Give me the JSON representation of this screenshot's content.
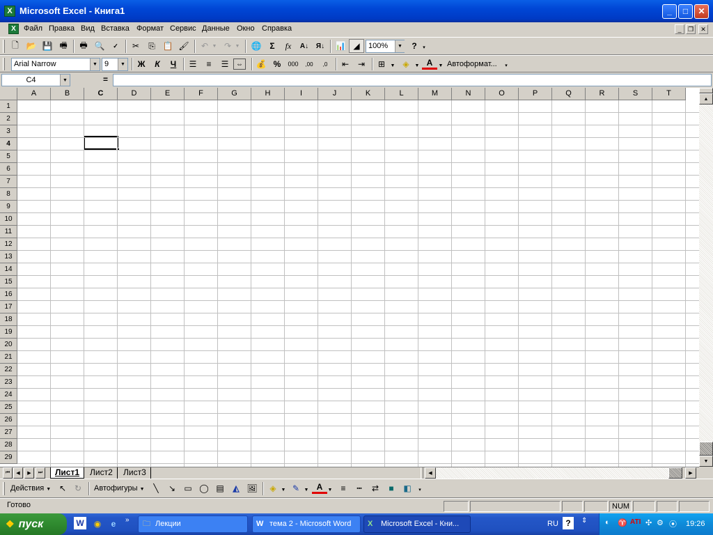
{
  "window": {
    "title": "Microsoft Excel - Книга1",
    "app_icon": "X"
  },
  "menu": {
    "items": [
      "Файл",
      "Правка",
      "Вид",
      "Вставка",
      "Формат",
      "Сервис",
      "Данные",
      "Окно",
      "Справка"
    ]
  },
  "standard_toolbar": {
    "zoom": "100%"
  },
  "format_toolbar": {
    "font": "Arial Narrow",
    "size": "9",
    "bold": "Ж",
    "italic": "К",
    "underline": "Ч",
    "autoformat": "Автоформат..."
  },
  "formula_bar": {
    "name_box": "C4",
    "equals": "=",
    "value": ""
  },
  "grid": {
    "columns": [
      "A",
      "B",
      "C",
      "D",
      "E",
      "F",
      "G",
      "H",
      "I",
      "J",
      "K",
      "L",
      "M",
      "N",
      "O",
      "P",
      "Q",
      "R",
      "S",
      "T"
    ],
    "rows": [
      "1",
      "2",
      "3",
      "4",
      "5",
      "6",
      "7",
      "8",
      "9",
      "10",
      "11",
      "12",
      "13",
      "14",
      "15",
      "16",
      "17",
      "18",
      "19",
      "20",
      "21",
      "22",
      "23",
      "24",
      "25",
      "26",
      "27",
      "28",
      "29"
    ],
    "selected_cell": "C4"
  },
  "sheets": {
    "tabs": [
      "Лист1",
      "Лист2",
      "Лист3"
    ],
    "active": "Лист1"
  },
  "drawing_toolbar": {
    "actions": "Действия",
    "autoshapes": "Автофигуры"
  },
  "status": {
    "text": "Готово",
    "num": "NUM"
  },
  "taskbar": {
    "start": "пуск",
    "tasks": [
      "Лекции",
      "тема 2 - Microsoft Word",
      "Microsoft Excel - Кни..."
    ],
    "lang": "RU",
    "clock": "19:26"
  }
}
